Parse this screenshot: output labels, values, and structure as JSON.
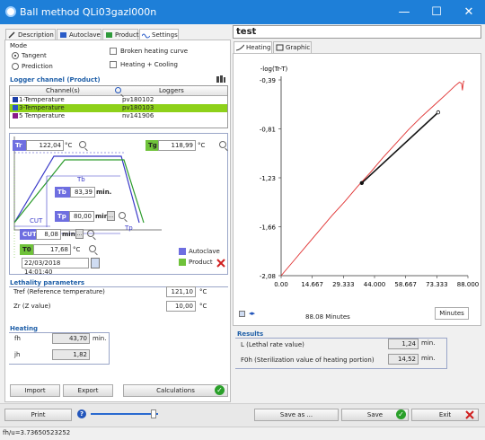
{
  "window": {
    "title": "Ball method QLi03gazl000n",
    "minimize": "—",
    "maximize": "☐",
    "close": "✕"
  },
  "tabs": [
    {
      "label": "Description"
    },
    {
      "label": "Autoclave"
    },
    {
      "label": "Product"
    },
    {
      "label": "Settings"
    }
  ],
  "mode": {
    "heading": "Mode",
    "options": [
      "Tangent",
      "Prediction"
    ],
    "selected": "Tangent",
    "checkboxes": [
      "Broken heating curve",
      "Heating + Cooling"
    ]
  },
  "logger": {
    "heading": "Logger channel (Product)",
    "columns": [
      "Channel(s)",
      "Loggers"
    ],
    "rows": [
      {
        "channel": "1-Temperature",
        "logger": "pv180102",
        "color": "#1a3da8"
      },
      {
        "channel": "3-Temperature",
        "logger": "pv180103",
        "color": "#2a57c8"
      },
      {
        "channel": "5 Temperature",
        "logger": "nv141906",
        "color": "#8a1a8a"
      }
    ]
  },
  "diagram": {
    "tr_label": "Tr",
    "tr_value": "122,04",
    "tr_unit": "°C",
    "tg_label": "Tg",
    "tg_value": "118,99",
    "tg_unit": "°C",
    "tb_caption": "Tb",
    "tb_label": "Tb",
    "tb_value": "83,39",
    "tb_unit": "min.",
    "tp_caption": "Tp",
    "tp_label": "Tp",
    "tp_value": "80,00",
    "tp_unit": "min.",
    "cut_caption": "CUT",
    "cut_label": "CUT",
    "cut_value": "8,08",
    "cut_unit": "min",
    "t0_label": "T0",
    "t0_value": "17,68",
    "t0_unit": "°C",
    "datetime": "22/03/2018 14:01:40",
    "legend": [
      "Autoclave",
      "Product"
    ],
    "legend_colors": [
      "#6e6ee0",
      "#6fc23a"
    ]
  },
  "lethality": {
    "heading": "Lethality parameters",
    "tref_label": "Tref (Reference temperature)",
    "tref_value": "121,10",
    "tref_unit": "°C",
    "zr_label": "Zr (Z value)",
    "zr_value": "10,00",
    "zr_unit": "°C"
  },
  "heating": {
    "heading": "Heating",
    "fh_label": "fh",
    "fh_value": "43,70",
    "fh_unit": "min.",
    "jh_label": "jh",
    "jh_value": "1,82"
  },
  "buttons": {
    "import": "Import",
    "export": "Export",
    "calculations": "Calculations",
    "print": "Print",
    "save_as": "Save as ...",
    "save": "Save",
    "exit": "Exit"
  },
  "right": {
    "name_value": "test",
    "tabs": [
      "Heating",
      "Graphic"
    ],
    "units_button": "Minutes",
    "cursor_readout": "88.08 Minutes"
  },
  "chart_data": {
    "type": "line",
    "ylabel": "-log(Tr-T)",
    "y_ticks": [
      "-0,39",
      "-0,81",
      "-1,23",
      "-1,66",
      "-2,08"
    ],
    "ylim": [
      -2.08,
      -0.39
    ],
    "x_ticks": [
      "0.00",
      "14.667",
      "29.333",
      "44.000",
      "58.667",
      "73.333",
      "88.000"
    ],
    "xlim": [
      0,
      88
    ],
    "series": [
      {
        "color": "#e03030",
        "x": [
          0,
          6,
          12,
          18,
          24,
          30,
          36,
          42,
          48,
          54,
          60,
          66,
          72,
          78,
          82,
          84,
          85,
          85.4,
          85.7,
          86.0,
          86.3
        ],
        "y": [
          -2.08,
          -1.95,
          -1.82,
          -1.69,
          -1.56,
          -1.44,
          -1.31,
          -1.19,
          -1.06,
          -0.94,
          -0.82,
          -0.71,
          -0.61,
          -0.51,
          -0.44,
          -0.41,
          -0.42,
          -0.48,
          -0.43,
          -0.4,
          -0.4
        ]
      },
      {
        "color": "#111111",
        "x": [
          38,
          74
        ],
        "y": [
          -1.28,
          -0.67
        ]
      }
    ],
    "grid": false
  },
  "results": {
    "heading": "Results",
    "l_label": "L (Lethal rate value)",
    "l_value": "1,24",
    "l_unit": "min.",
    "f0_label": "F0h (Sterilization value of heating portion)",
    "f0_value": "14,52",
    "f0_unit": "min."
  },
  "status_text": "fh/u=3.73650523252"
}
